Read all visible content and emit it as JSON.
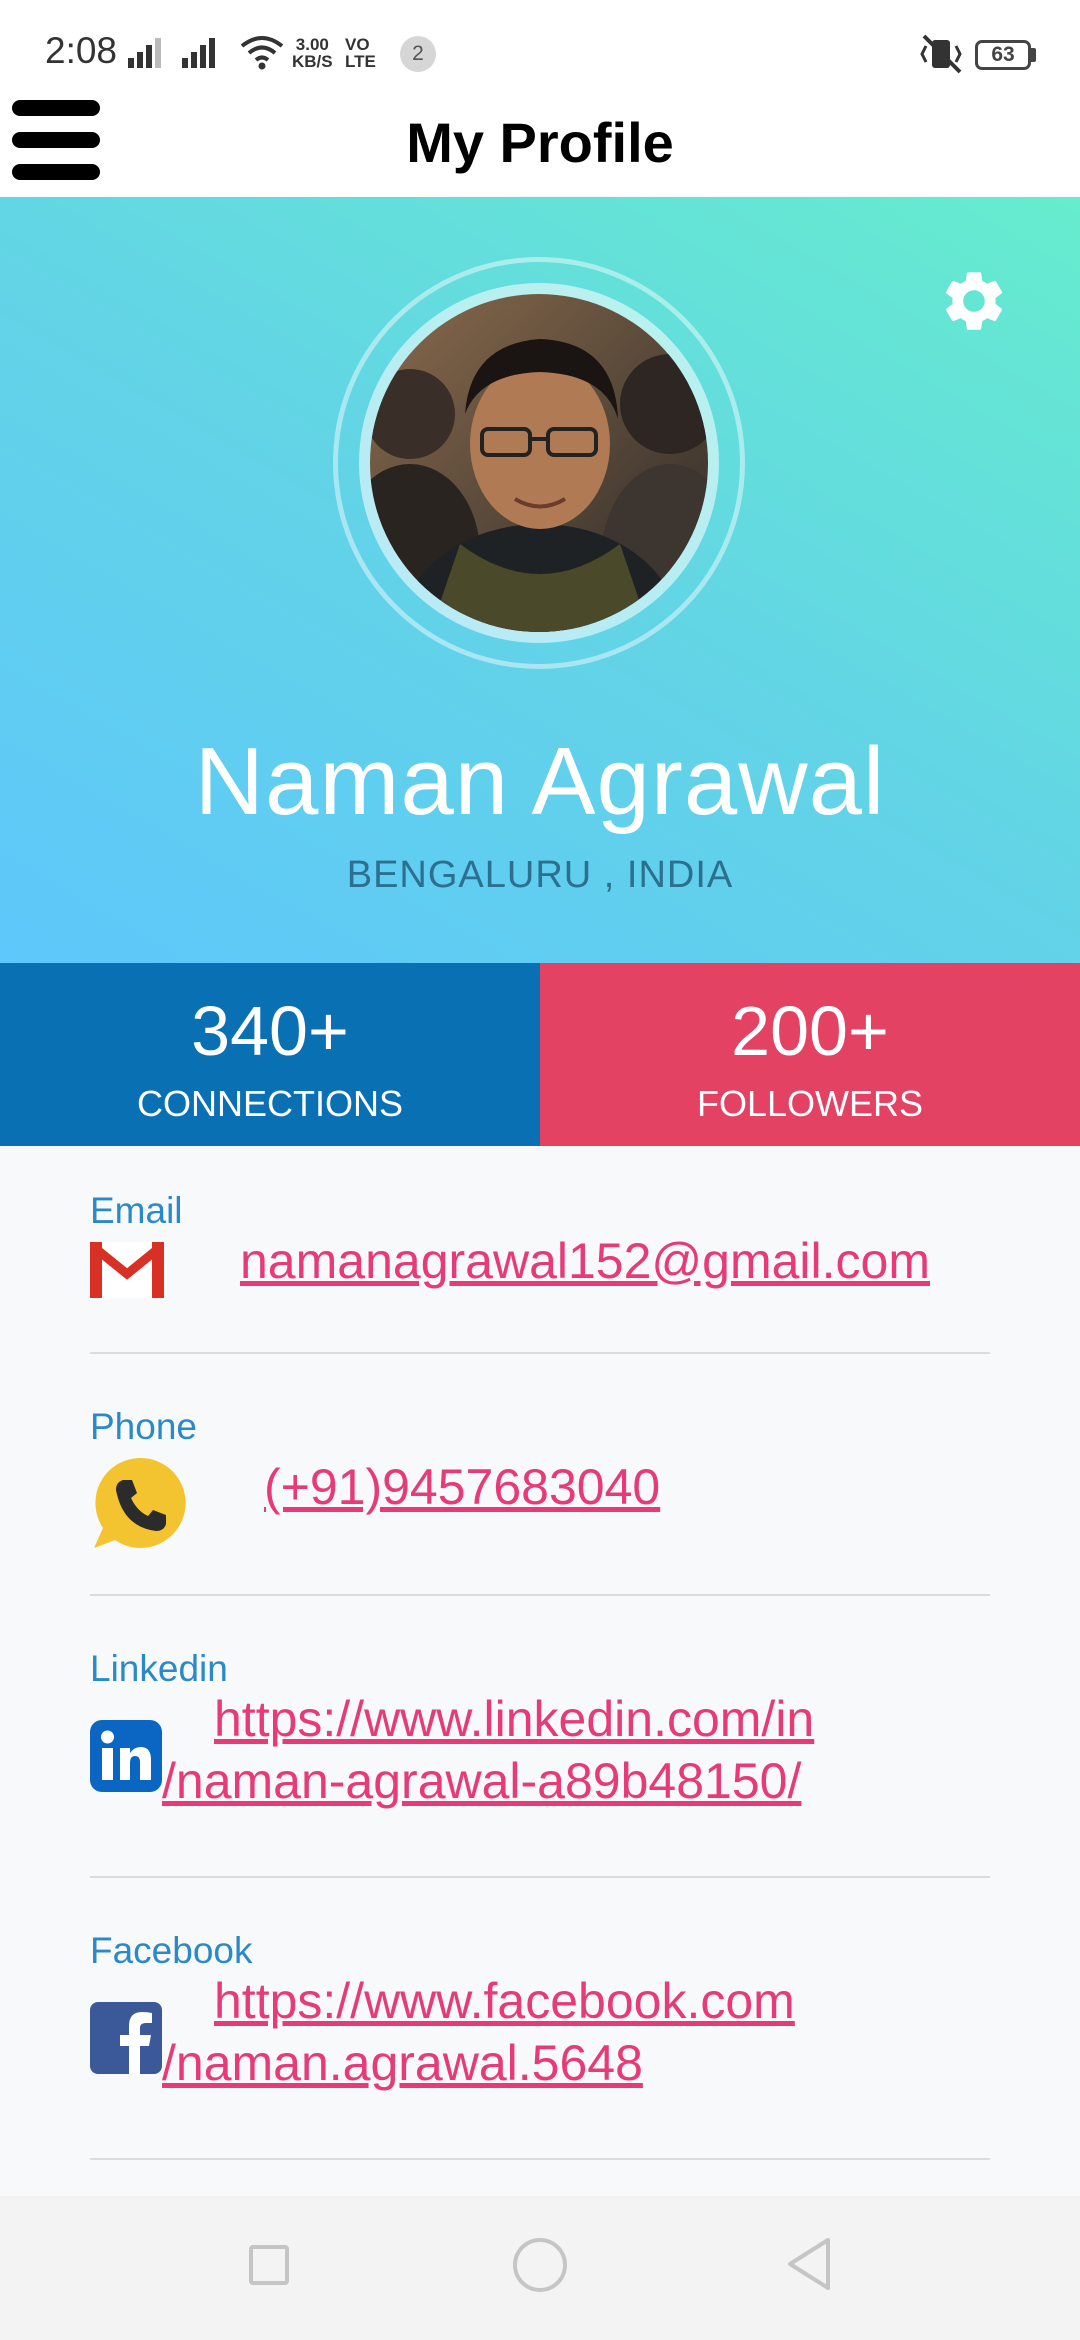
{
  "status_bar": {
    "time": "2:08",
    "net_speed_value": "3.00",
    "net_speed_unit": "KB/S",
    "volte_top": "VO",
    "volte_bottom": "LTE",
    "notification_count": "2",
    "battery": "63",
    "icons": [
      "signal-icon",
      "signal-icon",
      "wifi-icon",
      "vibrate-icon",
      "battery-icon"
    ]
  },
  "app_bar": {
    "title": "My Profile",
    "menu_icon": "hamburger-icon"
  },
  "profile": {
    "name": "Naman Agrawal",
    "location": "BENGALURU , INDIA",
    "settings_icon": "gear-icon",
    "avatar": "profile-photo"
  },
  "stats": {
    "connections": {
      "value": "340+",
      "label": "CONNECTIONS"
    },
    "followers": {
      "value": "200+",
      "label": "FOLLOWERS"
    }
  },
  "contacts": {
    "email": {
      "label": "Email",
      "value": "namanagrawal152@gmail.com",
      "icon": "gmail-icon"
    },
    "phone": {
      "label": "Phone",
      "value": "(+91)9457683040",
      "icon": "phone-icon"
    },
    "linkedin": {
      "label": "Linkedin",
      "line1": "https://www.linkedin.com/in",
      "line2": "/naman-agrawal-a89b48150/",
      "icon": "linkedin-icon"
    },
    "facebook": {
      "label": "Facebook",
      "line1": "https://www.facebook.com",
      "line2": "/naman.agrawal.5648",
      "icon": "facebook-icon"
    }
  },
  "nav_bar": {
    "buttons": [
      "recents-button",
      "home-button",
      "back-button"
    ]
  },
  "colors": {
    "gradient_start": "#5ec7fb",
    "gradient_end": "#66ecce",
    "connections_bg": "#0a70b4",
    "followers_bg": "#e34263",
    "label_blue": "#2a8ac8",
    "link_pink": "#e63b77",
    "location_text": "#2c6f8f"
  }
}
